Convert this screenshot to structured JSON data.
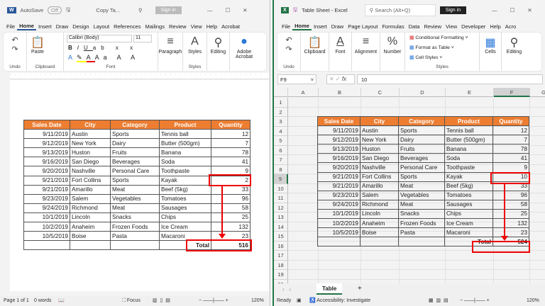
{
  "word": {
    "autosave": "AutoSave",
    "toggle": "Off",
    "doc_title": "Copy Ta...",
    "sign_in": "Sign in",
    "tabs": [
      "File",
      "Home",
      "Insert",
      "Draw",
      "Design",
      "Layout",
      "References",
      "Mailings",
      "Review",
      "View",
      "Help",
      "Acrobat"
    ],
    "font_name": "Calibri (Body)",
    "font_size": "11",
    "groups": {
      "undo": "Undo",
      "clipboard": "Clipboard",
      "paste": "Paste",
      "font": "Font",
      "paragraph": "Paragraph",
      "styles": "Styles",
      "styles_label": "Styles",
      "editing": "Editing",
      "acrobat": "Adobe Acrobat"
    },
    "status": {
      "page": "Page 1 of 1",
      "words": "0 words",
      "focus": "Focus",
      "zoom": "120%"
    },
    "table": {
      "headers": [
        "Sales Date",
        "City",
        "Category",
        "Product",
        "Quantity"
      ],
      "rows": [
        [
          "9/11/2019",
          "Austin",
          "Sports",
          "Tennis ball",
          "12"
        ],
        [
          "9/12/2019",
          "New York",
          "Dairy",
          "Butter (500gm)",
          "7"
        ],
        [
          "9/13/2019",
          "Huston",
          "Fruits",
          "Banana",
          "78"
        ],
        [
          "9/16/2019",
          "San Diego",
          "Beverages",
          "Soda",
          "41"
        ],
        [
          "9/20/2019",
          "Nashville",
          "Personal Care",
          "Toothpaste",
          "9"
        ],
        [
          "9/21/2019",
          "Fort Collins",
          "Sports",
          "Kayak",
          "2"
        ],
        [
          "9/21/2019",
          "Amarillo",
          "Meat",
          "Beef (5kg)",
          "33"
        ],
        [
          "9/23/2019",
          "Salem",
          "Vegetables",
          "Tomatoes",
          "96"
        ],
        [
          "9/24/2019",
          "Richmond",
          "Meat",
          "Sausages",
          "58"
        ],
        [
          "10/1/2019",
          "Lincoln",
          "Snacks",
          "Chips",
          "25"
        ],
        [
          "10/2/2019",
          "Anaheim",
          "Frozen Foods",
          "Ice Cream",
          "132"
        ],
        [
          "10/5/2019",
          "Boise",
          "Pasta",
          "Macaroni",
          "23"
        ]
      ],
      "total_label": "Total",
      "total": "516"
    }
  },
  "excel": {
    "doc_title": "Table Sheet - Excel",
    "search": "Search (Alt+Q)",
    "sign_in": "Sign in",
    "tabs": [
      "File",
      "Home",
      "Insert",
      "Draw",
      "Page Layout",
      "Formulas",
      "Data",
      "Review",
      "View",
      "Developer",
      "Help",
      "Acro"
    ],
    "groups": {
      "undo": "Undo",
      "clipboard": "Clipboard",
      "font": "Font",
      "alignment": "Alignment",
      "number": "Number",
      "cond": "Conditional Formatting",
      "fmt_table": "Format as Table",
      "cell_styles": "Cell Styles",
      "styles": "Styles",
      "cells": "Cells",
      "editing": "Editing"
    },
    "name_box": "F9",
    "formula": "10",
    "columns": [
      "A",
      "B",
      "C",
      "D",
      "E",
      "F",
      "G"
    ],
    "row_numbers": [
      "1",
      "2",
      "3",
      "4",
      "5",
      "6",
      "7",
      "8",
      "9",
      "10",
      "11",
      "12",
      "13",
      "14",
      "15",
      "16",
      "17",
      "18",
      "19",
      "20"
    ],
    "sheet_tab": "Table",
    "status": {
      "ready": "Ready",
      "accessibility": "Accessibility: Investigate",
      "zoom": "120%"
    },
    "table": {
      "headers": [
        "Sales Date",
        "City",
        "Category",
        "Product",
        "Quantity"
      ],
      "rows": [
        [
          "9/11/2019",
          "Austin",
          "Sports",
          "Tennis ball",
          "12"
        ],
        [
          "9/12/2019",
          "New York",
          "Dairy",
          "Butter (500gm)",
          "7"
        ],
        [
          "9/13/2019",
          "Huston",
          "Fruits",
          "Banana",
          "78"
        ],
        [
          "9/16/2019",
          "San Diego",
          "Beverages",
          "Soda",
          "41"
        ],
        [
          "9/20/2019",
          "Nashville",
          "Personal Care",
          "Toothpaste",
          "9"
        ],
        [
          "9/21/2019",
          "Fort Collins",
          "Sports",
          "Kayak",
          "10"
        ],
        [
          "9/21/2019",
          "Amarillo",
          "Meat",
          "Beef (5kg)",
          "33"
        ],
        [
          "9/23/2019",
          "Salem",
          "Vegetables",
          "Tomatoes",
          "96"
        ],
        [
          "9/24/2019",
          "Richmond",
          "Meat",
          "Sausages",
          "58"
        ],
        [
          "10/1/2019",
          "Lincoln",
          "Snacks",
          "Chips",
          "25"
        ],
        [
          "10/2/2019",
          "Anaheim",
          "Frozen Foods",
          "Ice Cream",
          "132"
        ],
        [
          "10/5/2019",
          "Boise",
          "Pasta",
          "Macaroni",
          "23"
        ]
      ],
      "total_label": "Total",
      "total": "524"
    }
  }
}
